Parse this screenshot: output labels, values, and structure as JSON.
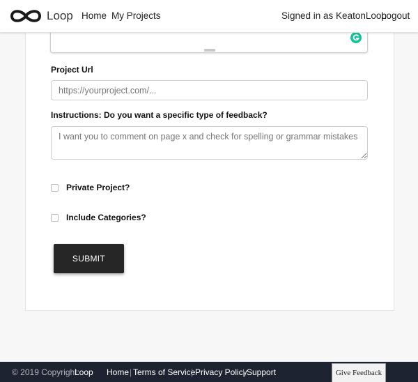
{
  "navbar": {
    "brand": "Loop",
    "links": [
      "Home",
      "My Projects"
    ],
    "signed_in_text": "Signed in as KeatonLoop",
    "logout_label": "Logout"
  },
  "form": {
    "project_url": {
      "label": "Project Url",
      "placeholder": "https://yourproject.com/..."
    },
    "instructions": {
      "label": "Instructions: Do you want a specific type of feedback?",
      "placeholder": "I want you to comment on page x and check for spelling or grammar mistakes"
    },
    "private_label": "Private Project?",
    "categories_label": "Include Categories?",
    "submit_label": "SUBMIT"
  },
  "footer": {
    "copyright": "© 2019 Copyright:",
    "brand": "Loop",
    "links": [
      "Home",
      "Terms of Service",
      "Privacy Policy",
      "Support"
    ],
    "separator": "|"
  },
  "give_feedback_label": "Give Feedback",
  "colors": {
    "footer_bg": "#1d2330",
    "button_bg": "#262626",
    "grammarly": "#15c39a"
  }
}
